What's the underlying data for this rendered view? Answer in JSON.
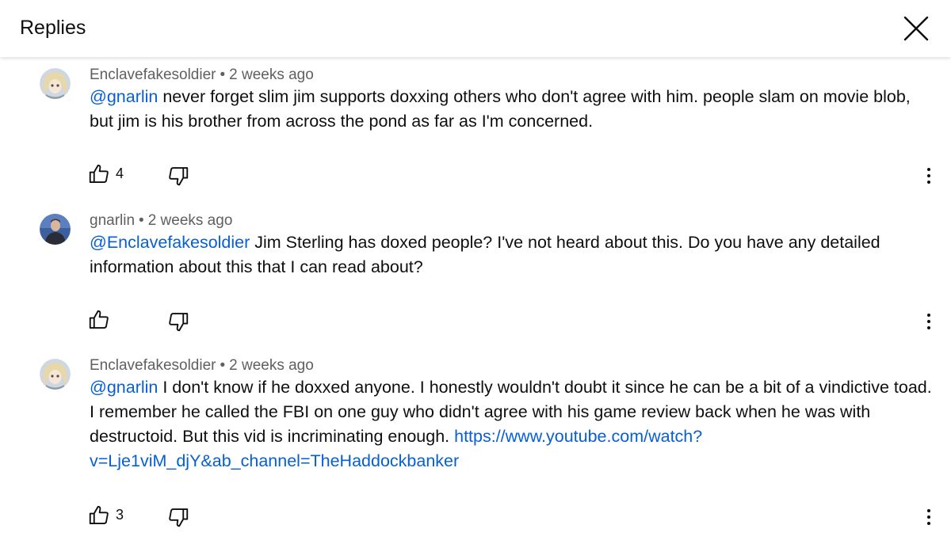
{
  "header": {
    "title": "Replies"
  },
  "comments": [
    {
      "author": "Enclavefakesoldier",
      "separator": "•",
      "time": "2 weeks ago",
      "mention": "@gnarlin",
      "text": " never forget slim jim supports doxxing others who don't agree with him. people slam on movie blob, but jim is his brother from across the pond as far as I'm concerned.",
      "likes": "4"
    },
    {
      "author": "gnarlin",
      "separator": "•",
      "time": "2 weeks ago",
      "mention": "@Enclavefakesoldier",
      "text": " Jim Sterling has doxed people? I've not heard about this. Do you have any detailed information about this that I can read about?",
      "likes": ""
    },
    {
      "author": "Enclavefakesoldier",
      "separator": "•",
      "time": "2 weeks ago",
      "mention": "@gnarlin",
      "text": " I don't know if he doxxed anyone. I honestly wouldn't doubt it since he can be a bit of a vindictive toad. I remember he called the FBI on one guy who didn't agree with his game review back when he was with destructoid. But this vid is incriminating enough. ",
      "link": "https://www.youtube.com/watch?v=Lje1viM_djY&ab_channel=TheHaddockbanker",
      "likes": "3"
    }
  ],
  "icons": {
    "close": "close-icon",
    "like": "thumbs-up-icon",
    "dislike": "thumbs-down-icon",
    "more": "more-vertical-icon"
  },
  "colors": {
    "link": "#065fd4",
    "meta": "#606060",
    "text": "#0f0f0f"
  }
}
